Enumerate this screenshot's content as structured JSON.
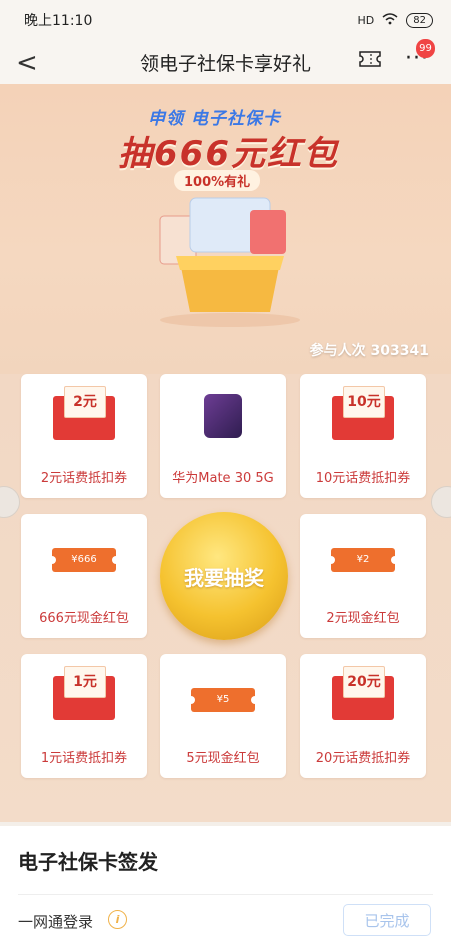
{
  "status": {
    "time": "晚上11:10",
    "signal": "HD",
    "battery": "82"
  },
  "header": {
    "title": "领电子社保卡享好礼",
    "back": "<",
    "more": "···",
    "badge": "99"
  },
  "banner": {
    "subtitle": "申领 电子社保卡",
    "headline": "抽666元红包",
    "pill": "100%有礼",
    "participants_label": "参与人次 303341"
  },
  "prizes": [
    {
      "label": "2元话费抵扣券",
      "face": "2元"
    },
    {
      "label": "华为Mate 30 5G",
      "face": ""
    },
    {
      "label": "10元话费抵扣券",
      "face": "10元"
    },
    {
      "label": "666元现金红包",
      "face": "¥666"
    },
    {
      "label": "2元现金红包",
      "face": "¥2"
    },
    {
      "label": "1元话费抵扣券",
      "face": "1元"
    },
    {
      "label": "5元现金红包",
      "face": "¥5"
    },
    {
      "label": "20元话费抵扣券",
      "face": "20元"
    }
  ],
  "draw_button": "我要抽奖",
  "panel": {
    "title": "电子社保卡签发",
    "login_label": "一网通登录",
    "info": "i",
    "done_button": "已完成"
  },
  "colors": {
    "accent": "#cb3a3a",
    "gold": "#f5c22f",
    "link": "#3b78e6"
  }
}
